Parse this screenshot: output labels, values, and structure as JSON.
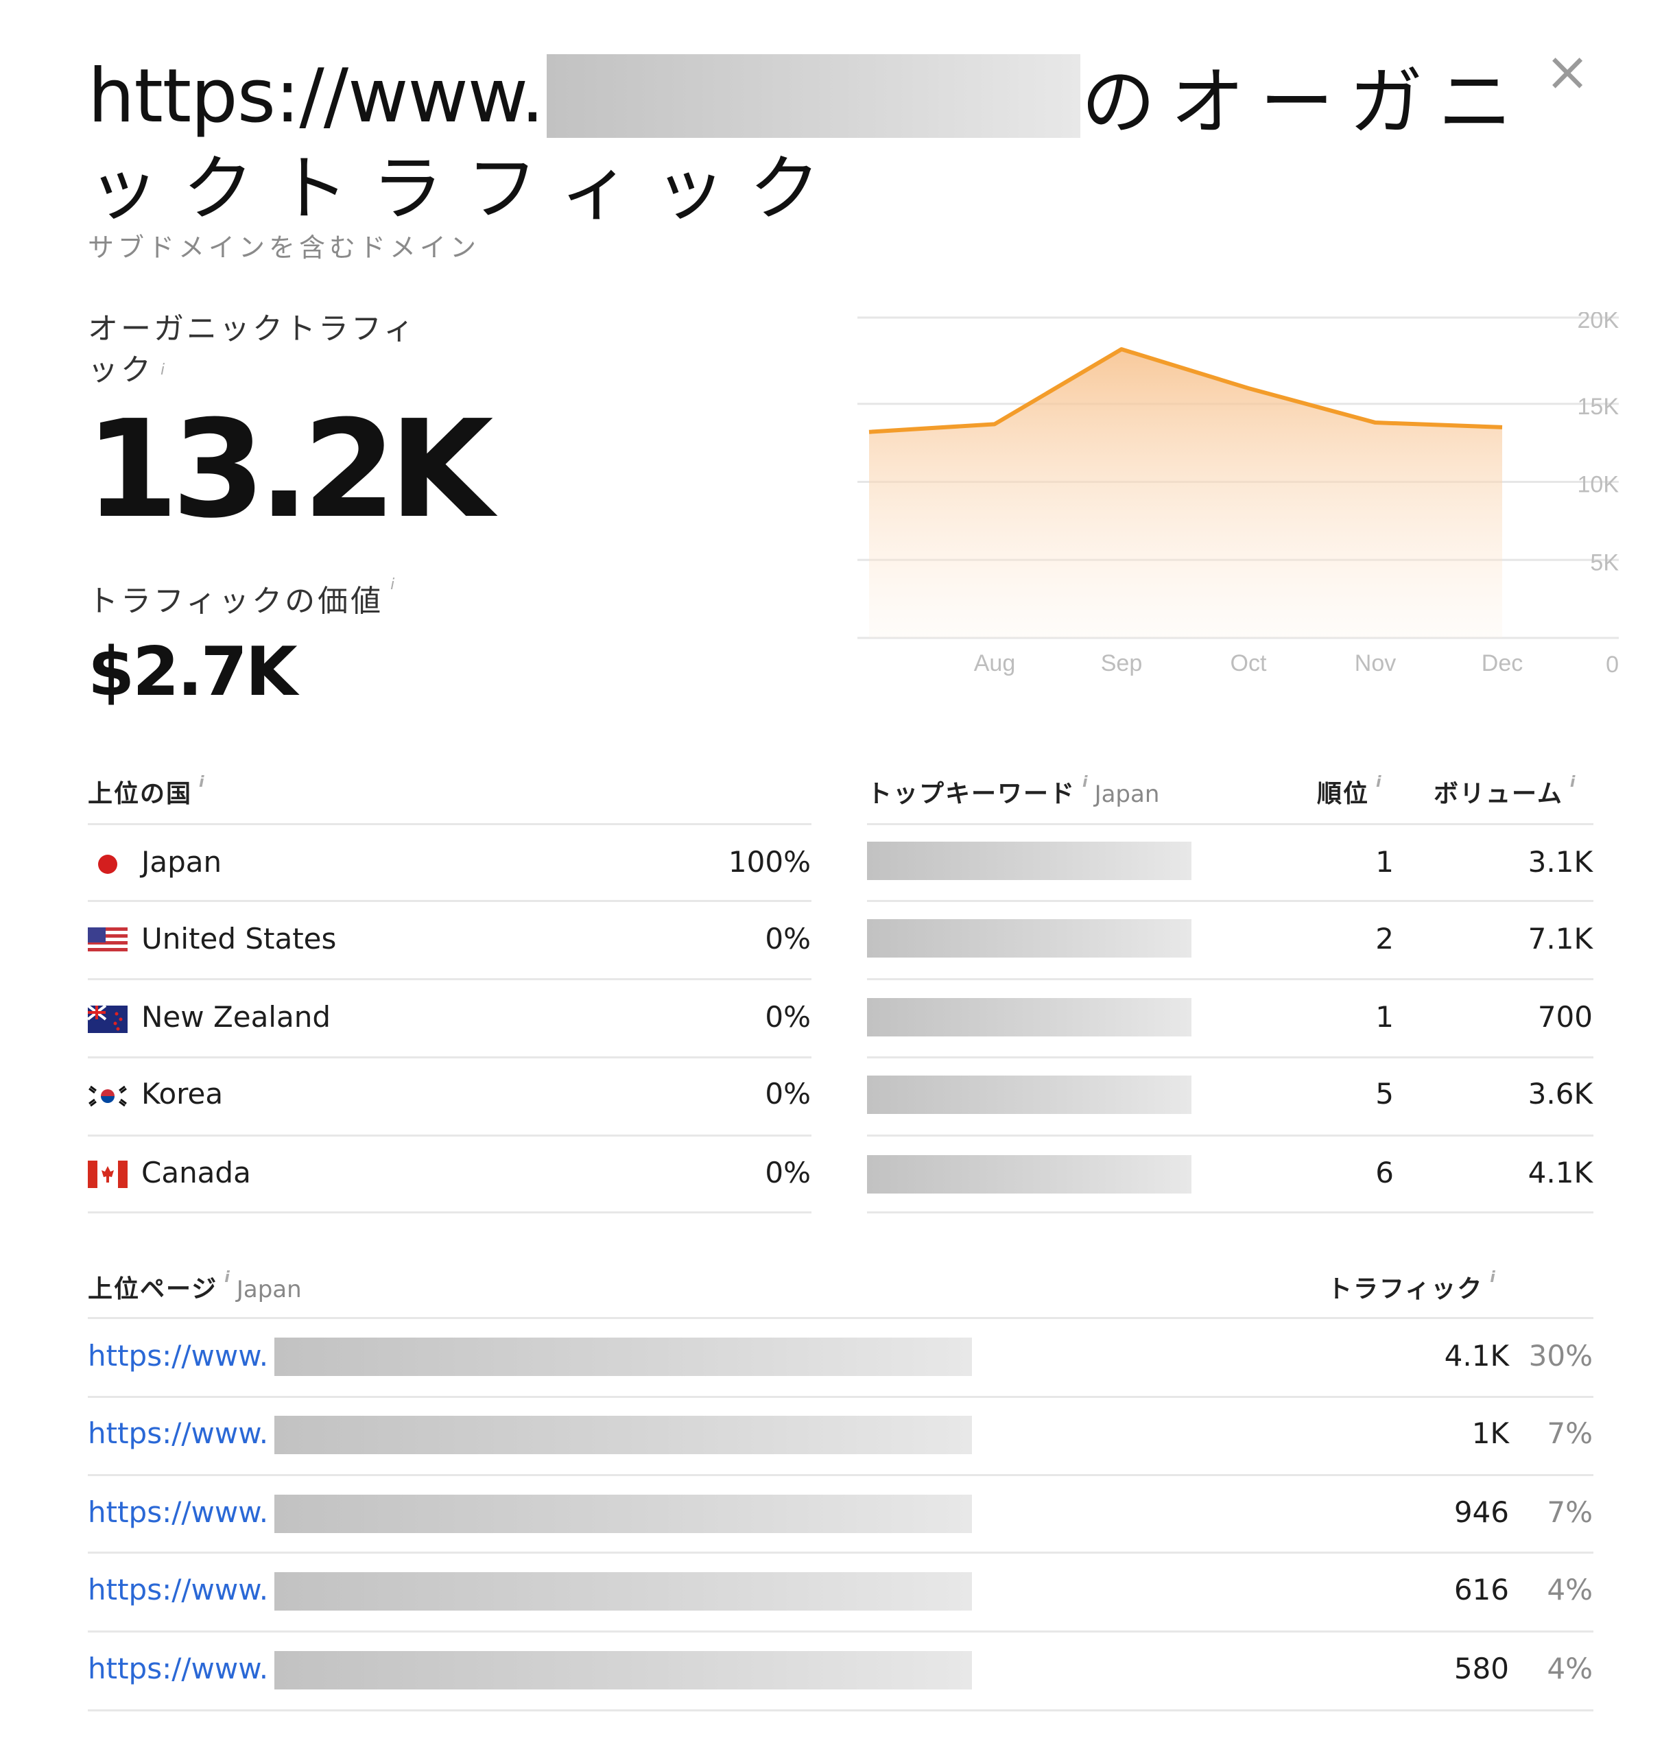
{
  "header": {
    "title_prefix": "https://www.",
    "title_suffix": "のオーガニ",
    "title_line2": "ックトラフィック",
    "subtitle": "サブドメインを含むドメイン",
    "close_label": "×"
  },
  "metrics": {
    "traffic_label": "オーガニックトラフィック",
    "traffic_value": "13.2K",
    "value_label": "トラフィックの価値",
    "value_value": "$2.7K",
    "info_icon": "i"
  },
  "chart_data": {
    "type": "area",
    "categories": [
      "",
      "Aug",
      "Sep",
      "Oct",
      "Nov",
      "Dec"
    ],
    "values": [
      13200,
      13700,
      18500,
      16000,
      13800,
      13500
    ],
    "y_ticks": [
      "20K",
      "15K",
      "10K",
      "5K",
      "0"
    ],
    "x_ticks": [
      "Aug",
      "Sep",
      "Oct",
      "Nov",
      "Dec"
    ],
    "ylim": [
      0,
      20000
    ],
    "grid": true,
    "color": "#f39c2a"
  },
  "countries": {
    "header": "上位の国",
    "rows": [
      {
        "flag": "japan-flag-icon",
        "name": "Japan",
        "share": "100%"
      },
      {
        "flag": "us-flag-icon",
        "name": "United States",
        "share": "0%"
      },
      {
        "flag": "new-zealand-flag-icon",
        "name": "New Zealand",
        "share": "0%"
      },
      {
        "flag": "korea-flag-icon",
        "name": "Korea",
        "share": "0%"
      },
      {
        "flag": "canada-flag-icon",
        "name": "Canada",
        "share": "0%"
      }
    ]
  },
  "keywords": {
    "header": "トップキーワード",
    "region": "Japan",
    "col_rank": "順位",
    "col_volume": "ボリューム",
    "rows": [
      {
        "rank": "1",
        "volume": "3.1K"
      },
      {
        "rank": "2",
        "volume": "7.1K"
      },
      {
        "rank": "1",
        "volume": "700"
      },
      {
        "rank": "5",
        "volume": "3.6K"
      },
      {
        "rank": "6",
        "volume": "4.1K"
      }
    ]
  },
  "pages": {
    "header": "上位ページ",
    "region": "Japan",
    "col_traffic": "トラフィック",
    "rows": [
      {
        "url": "https://www.",
        "traffic": "4.1K",
        "share": "30%"
      },
      {
        "url": "https://www.",
        "traffic": "1K",
        "share": "7%"
      },
      {
        "url": "https://www.",
        "traffic": "946",
        "share": "7%"
      },
      {
        "url": "https://www.",
        "traffic": "616",
        "share": "4%"
      },
      {
        "url": "https://www.",
        "traffic": "580",
        "share": "4%"
      }
    ]
  }
}
